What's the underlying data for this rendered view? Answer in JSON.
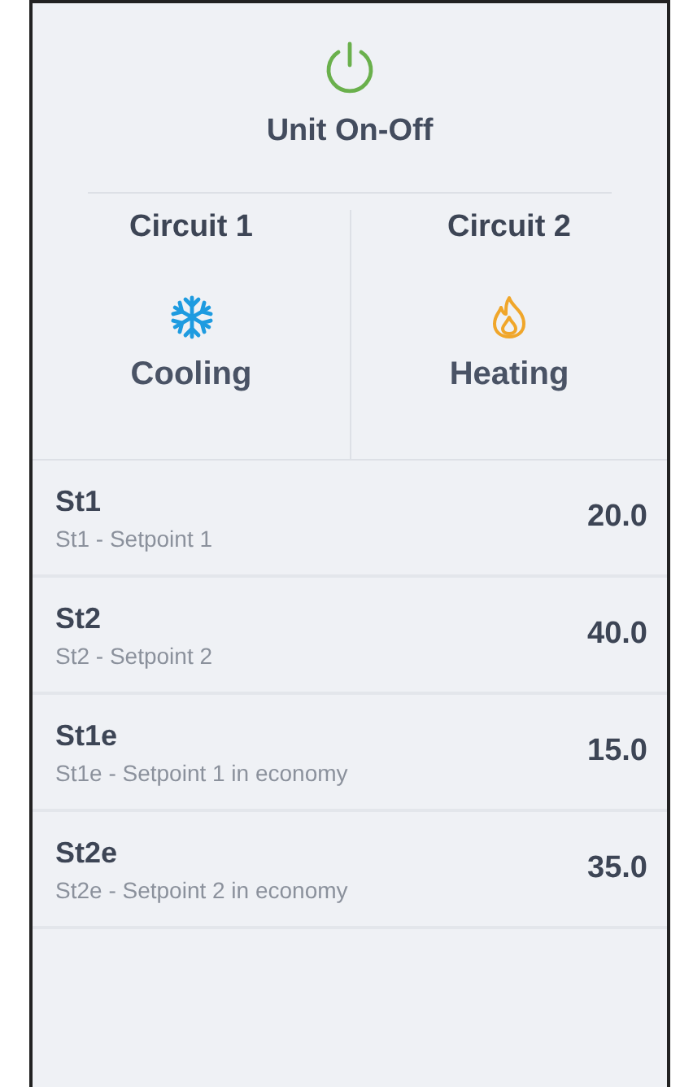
{
  "unit": {
    "label": "Unit On-Off"
  },
  "circuits": [
    {
      "name": "Circuit 1",
      "kind": "cooling",
      "mode": "Cooling"
    },
    {
      "name": "Circuit 2",
      "kind": "heating",
      "mode": "Heating"
    }
  ],
  "setpoints": [
    {
      "code": "St1",
      "description": "St1 - Setpoint 1",
      "value": "20.0"
    },
    {
      "code": "St2",
      "description": "St2 - Setpoint 2",
      "value": "40.0"
    },
    {
      "code": "St1e",
      "description": "St1e - Setpoint 1 in economy",
      "value": "15.0"
    },
    {
      "code": "St2e",
      "description": "St2e - Setpoint 2 in economy",
      "value": "35.0"
    }
  ]
}
